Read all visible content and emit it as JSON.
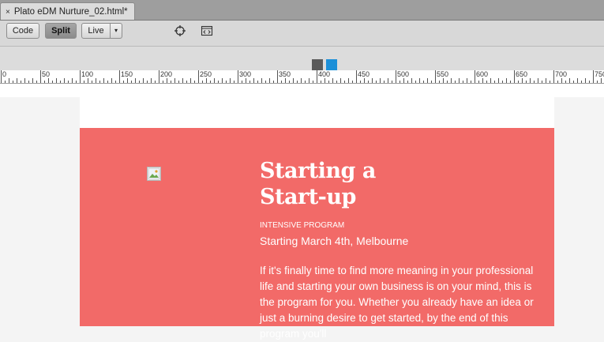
{
  "tab": {
    "close_glyph": "×",
    "title": "Plato eDM Nurture_02.html*"
  },
  "toolbar": {
    "code_label": "Code",
    "split_label": "Split",
    "live_label": "Live",
    "live_dropdown_glyph": "▾",
    "inspect_icon": "crosshair-icon",
    "code_nav_icon": "code-navigator-icon"
  },
  "media_queries": {
    "swatch_colors": [
      "#5a5a5a",
      "#1b8fd8"
    ]
  },
  "ruler": {
    "labels": [
      "0",
      "50",
      "100",
      "150",
      "200",
      "250",
      "300",
      "350",
      "400",
      "450",
      "500",
      "550",
      "600",
      "650",
      "700",
      "750"
    ]
  },
  "email": {
    "hero_bg_color": "#f26a68",
    "title": "Starting a\nStart-up",
    "eyebrow": "INTENSIVE PROGRAM",
    "date_line": "Starting March 4th, Melbourne",
    "body": "If it's finally time to find more meaning in your professional life and starting your own business is on your mind, this is the program for you. Whether you already have an idea or just a burning desire to get started, by the end of this program you'll"
  }
}
